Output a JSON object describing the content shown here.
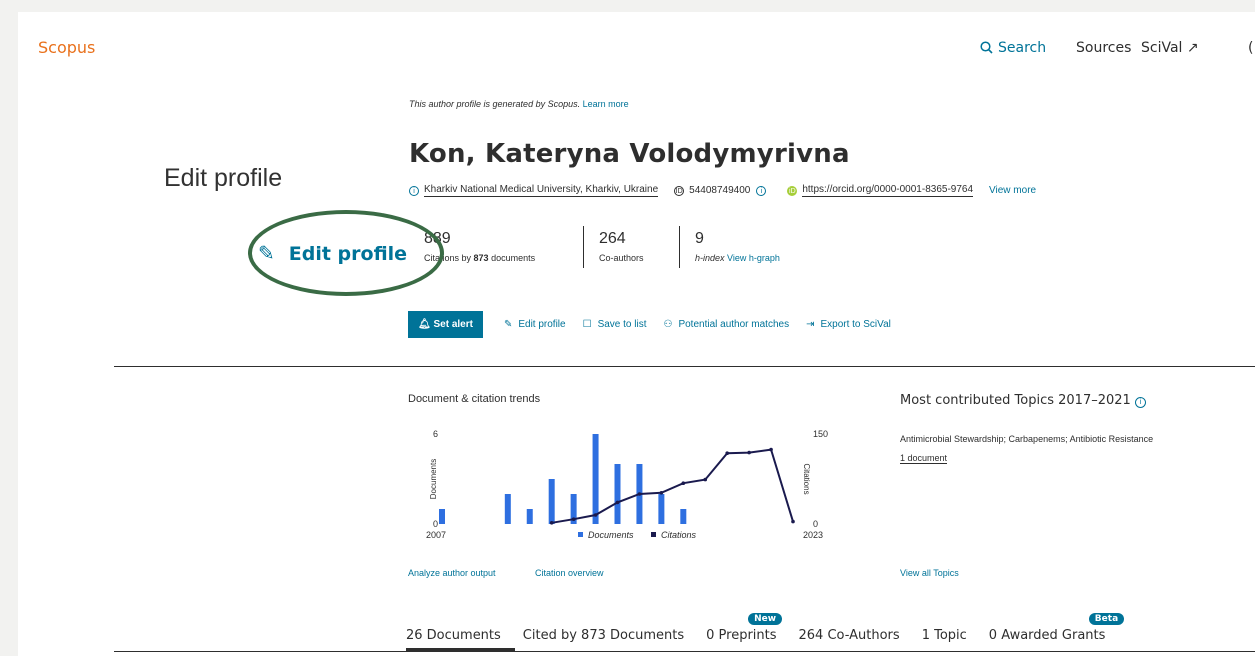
{
  "header": {
    "brand": "Scopus",
    "nav": {
      "search": "Search",
      "sources": "Sources",
      "scival": "SciVal ↗",
      "more": "("
    }
  },
  "profile": {
    "generated_note": "This author profile is generated by Scopus.",
    "learn_more": "Learn more",
    "name": "Kon, Kateryna Volodymyrivna",
    "affiliation": "Kharkiv National Medical University, Kharkiv, Ukraine",
    "author_id": "54408749400",
    "orcid": "https://orcid.org/0000-0001-8365-9764",
    "view_more": "View more"
  },
  "callout": {
    "label": "Edit profile",
    "zoomed_button": "Edit profile",
    "ellipse_color": "#3a6b45"
  },
  "metrics": {
    "citations": {
      "value": "889",
      "label_pre": "Citations by ",
      "label_bold": "873",
      "label_post": " documents"
    },
    "coauthors": {
      "value": "264",
      "label": "Co-authors"
    },
    "hindex": {
      "value": "9",
      "label": "h-index",
      "link": "View h-graph"
    }
  },
  "actions": {
    "set_alert": "Set alert",
    "edit_profile": "Edit profile",
    "save_to_list": "Save to list",
    "potential_matches": "Potential author matches",
    "export": "Export to SciVal"
  },
  "trends": {
    "title": "Document & citation trends",
    "analyze_link": "Analyze author output",
    "overview_link": "Citation overview"
  },
  "chart_data": {
    "type": "bar",
    "x_start_label": "2007",
    "x_end_label": "2023",
    "categories": [
      "2007",
      "2008",
      "2009",
      "2010",
      "2011",
      "2012",
      "2013",
      "2014",
      "2015",
      "2016",
      "2017",
      "2018",
      "2019",
      "2020",
      "2021",
      "2022",
      "2023"
    ],
    "series": [
      {
        "name": "Documents",
        "type": "bar",
        "axis": "left",
        "color": "#2e6fe0",
        "values": [
          1,
          0,
          0,
          2,
          1,
          3,
          2,
          6,
          4,
          4,
          2,
          1,
          0,
          0,
          0,
          0,
          0
        ]
      },
      {
        "name": "Citations",
        "type": "line",
        "axis": "right",
        "color": "#1a1a4e",
        "values": [
          null,
          null,
          null,
          null,
          null,
          2,
          8,
          15,
          36,
          50,
          52,
          68,
          74,
          118,
          119,
          124,
          4
        ]
      }
    ],
    "ylabel_left": "Documents",
    "ylabel_right": "Citations",
    "ylim_left": [
      0,
      6
    ],
    "ylim_right": [
      0,
      150
    ],
    "left_ticks": [
      "6",
      "0"
    ],
    "right_ticks": [
      "150",
      "0"
    ],
    "legend_placement": "bottom-center"
  },
  "topics": {
    "title": "Most contributed Topics 2017–2021",
    "name": "Antimicrobial Stewardship; Carbapenems; Antibiotic Resistance",
    "docs": "1 document",
    "view_all": "View all Topics"
  },
  "tabs": [
    {
      "label": "26 Documents",
      "active": true
    },
    {
      "label": "Cited by 873 Documents"
    },
    {
      "label": "0 Preprints",
      "badge": "New"
    },
    {
      "label": "264 Co-Authors"
    },
    {
      "label": "1 Topic"
    },
    {
      "label": "0 Awarded Grants",
      "badge": "Beta"
    }
  ]
}
